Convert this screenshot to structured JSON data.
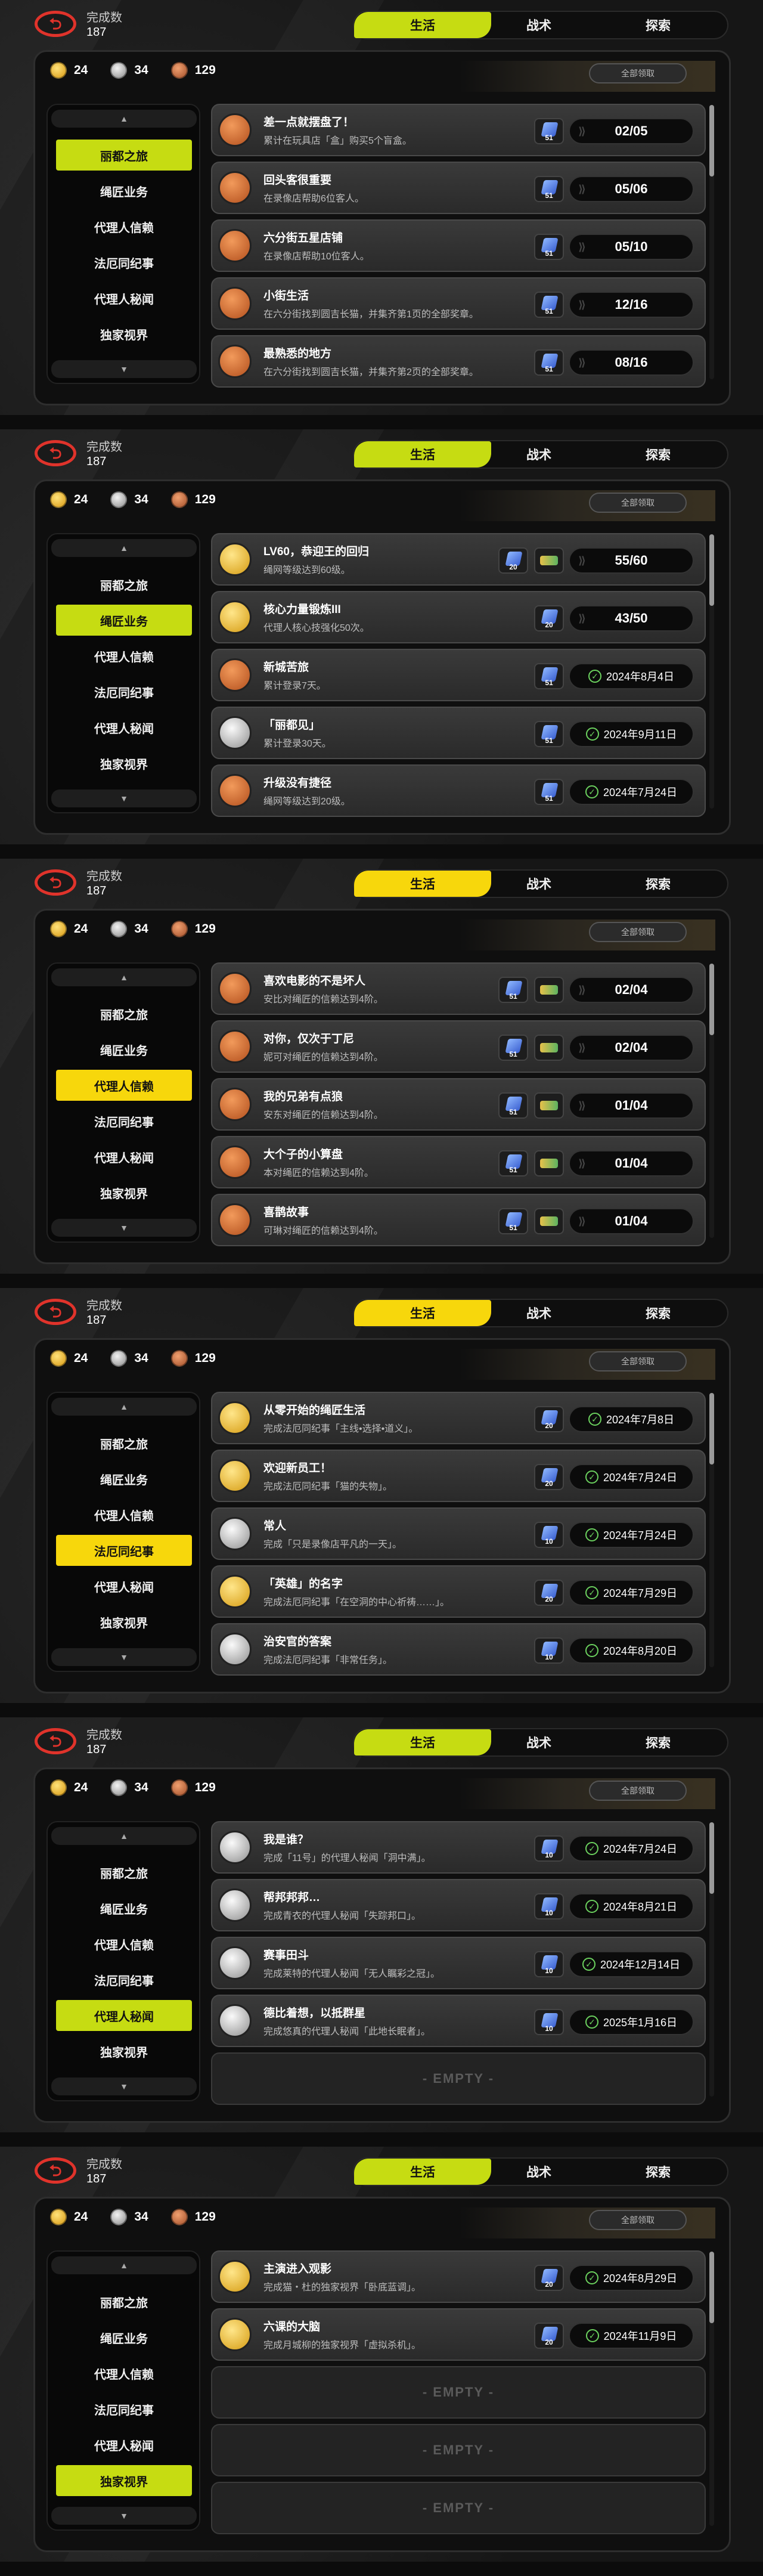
{
  "header": {
    "back_symbol": "⮌",
    "completion_label": "完成数",
    "completion_value": "187"
  },
  "tabs": [
    "生活",
    "战术",
    "探索"
  ],
  "currency": [
    {
      "type": "gold",
      "value": "24"
    },
    {
      "type": "silver",
      "value": "34"
    },
    {
      "type": "bronze",
      "value": "129"
    }
  ],
  "claim_all_label": "全部领取",
  "sidebar": [
    "丽都之旅",
    "绳匠业务",
    "代理人信赖",
    "法厄同纪事",
    "代理人秘闻",
    "独家视界"
  ],
  "scroll_up": "▲",
  "scroll_down": "▼",
  "empty_label": "- EMPTY -",
  "accent_colors": {
    "lime": "#c6dc12",
    "yellow": "#f7d70c"
  },
  "panels": [
    {
      "active_category": 0,
      "accent": "lime",
      "rows": [
        {
          "icon": "bronze",
          "title": "差一点就摆盘了！",
          "desc": "累计在玩具店「盒」购买5个盲盒。",
          "reward": "51",
          "status": "progress",
          "text": "02/05"
        },
        {
          "icon": "bronze",
          "title": "回头客很重要",
          "desc": "在录像店帮助6位客人。",
          "reward": "51",
          "status": "progress",
          "text": "05/06"
        },
        {
          "icon": "bronze",
          "title": "六分街五星店铺",
          "desc": "在录像店帮助10位客人。",
          "reward": "51",
          "status": "progress",
          "text": "05/10"
        },
        {
          "icon": "bronze",
          "title": "小街生活",
          "desc": "在六分街找到圆吉长猫，并集齐第1页的全部奖章。",
          "reward": "51",
          "status": "progress",
          "text": "12/16"
        },
        {
          "icon": "bronze",
          "title": "最熟悉的地方",
          "desc": "在六分街找到圆吉长猫，并集齐第2页的全部奖章。",
          "reward": "51",
          "status": "progress",
          "text": "08/16"
        }
      ]
    },
    {
      "active_category": 1,
      "accent": "lime",
      "rows": [
        {
          "icon": "gold",
          "title": "LV60，恭迎王的回归",
          "desc": "绳网等级达到60级。",
          "reward": "20",
          "reward2": true,
          "status": "progress",
          "text": "55/60"
        },
        {
          "icon": "gold",
          "title": "核心力量锻炼III",
          "desc": "代理人核心技强化50次。",
          "reward": "20",
          "status": "progress",
          "text": "43/50"
        },
        {
          "icon": "bronze",
          "title": "新城苦旅",
          "desc": "累计登录7天。",
          "reward": "51",
          "status": "done",
          "text": "2024年8月4日"
        },
        {
          "icon": "silver",
          "title": "「丽都见」",
          "desc": "累计登录30天。",
          "reward": "51",
          "status": "done",
          "text": "2024年9月11日"
        },
        {
          "icon": "bronze",
          "title": "升级没有捷径",
          "desc": "绳网等级达到20级。",
          "reward": "51",
          "status": "done",
          "text": "2024年7月24日"
        }
      ]
    },
    {
      "active_category": 2,
      "accent": "yellow",
      "rows": [
        {
          "icon": "bronze",
          "title": "喜欢电影的不是坏人",
          "desc": "安比对绳匠的信赖达到4阶。",
          "reward": "51",
          "reward2": true,
          "status": "progress",
          "text": "02/04"
        },
        {
          "icon": "bronze",
          "title": "对你，仅次于丁尼",
          "desc": "妮可对绳匠的信赖达到4阶。",
          "reward": "51",
          "reward2": true,
          "status": "progress",
          "text": "02/04"
        },
        {
          "icon": "bronze",
          "title": "我的兄弟有点狼",
          "desc": "安东对绳匠的信赖达到4阶。",
          "reward": "51",
          "reward2": true,
          "status": "progress",
          "text": "01/04"
        },
        {
          "icon": "bronze",
          "title": "大个子的小算盘",
          "desc": "本对绳匠的信赖达到4阶。",
          "reward": "51",
          "reward2": true,
          "status": "progress",
          "text": "01/04"
        },
        {
          "icon": "bronze",
          "title": "喜鹊故事",
          "desc": "可琳对绳匠的信赖达到4阶。",
          "reward": "51",
          "reward2": true,
          "status": "progress",
          "text": "01/04"
        }
      ]
    },
    {
      "active_category": 3,
      "accent": "yellow",
      "rows": [
        {
          "icon": "gold",
          "title": "从零开始的绳匠生活",
          "desc": "完成法厄同纪事「主线•选择•道义」。",
          "reward": "20",
          "status": "done",
          "text": "2024年7月8日"
        },
        {
          "icon": "gold",
          "title": "欢迎新员工！",
          "desc": "完成法厄同纪事「猫的失物」。",
          "reward": "20",
          "status": "done",
          "text": "2024年7月24日"
        },
        {
          "icon": "silver",
          "title": "常人",
          "desc": "完成「只是录像店平凡的一天」。",
          "reward": "10",
          "status": "done",
          "text": "2024年7月24日"
        },
        {
          "icon": "gold",
          "title": "「英雄」的名字",
          "desc": "完成法厄同纪事「在空洞的中心祈祷……」。",
          "reward": "20",
          "status": "done",
          "text": "2024年7月29日"
        },
        {
          "icon": "silver",
          "title": "治安官的答案",
          "desc": "完成法厄同纪事「非常任务」。",
          "reward": "10",
          "status": "done",
          "text": "2024年8月20日"
        }
      ]
    },
    {
      "active_category": 4,
      "accent": "lime",
      "rows": [
        {
          "icon": "silver",
          "title": "我是谁？",
          "desc": "完成「11号」的代理人秘闻「洞中满」。",
          "reward": "10",
          "status": "done",
          "text": "2024年7月24日"
        },
        {
          "icon": "silver",
          "title": "帮邦邦邦…",
          "desc": "完成青衣的代理人秘闻「失踪邦口」。",
          "reward": "10",
          "status": "done",
          "text": "2024年8月21日"
        },
        {
          "icon": "silver",
          "title": "赛事田斗",
          "desc": "完成莱特的代理人秘闻「无人瞩彩之冠」。",
          "reward": "10",
          "status": "done",
          "text": "2024年12月14日"
        },
        {
          "icon": "silver",
          "title": "德比着想，以抵群星",
          "desc": "完成悠真的代理人秘闻「此地长眠者」。",
          "reward": "10",
          "status": "done",
          "text": "2025年1月16日"
        },
        {
          "empty": true
        }
      ]
    },
    {
      "active_category": 5,
      "accent": "lime",
      "rows": [
        {
          "icon": "gold",
          "title": "主演进入观影",
          "desc": "完成猫・杜的独家视界「卧底蓝调」。",
          "reward": "20",
          "status": "done",
          "text": "2024年8月29日"
        },
        {
          "icon": "gold",
          "title": "六课的大脑",
          "desc": "完成月城柳的独家视界「虚拟杀机」。",
          "reward": "20",
          "status": "done",
          "text": "2024年11月9日"
        },
        {
          "empty": true
        },
        {
          "empty": true
        },
        {
          "empty": true
        }
      ]
    }
  ]
}
